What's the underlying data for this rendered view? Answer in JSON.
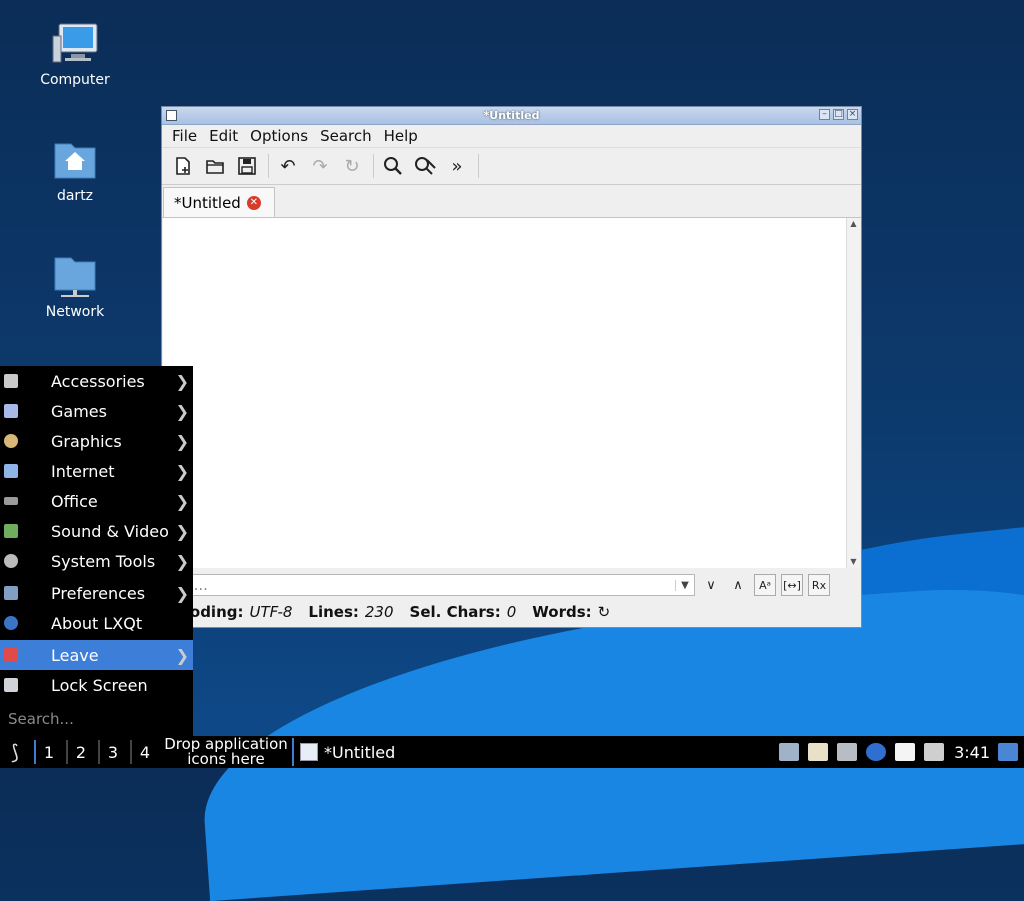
{
  "desktop": {
    "icons": [
      {
        "label": "Computer"
      },
      {
        "label": "dartz"
      },
      {
        "label": "Network"
      }
    ]
  },
  "window": {
    "title": "*Untitled",
    "menu": [
      "File",
      "Edit",
      "Options",
      "Search",
      "Help"
    ],
    "toolbar_icons": [
      "new-file-icon",
      "open-file-icon",
      "save-icon",
      "undo-icon",
      "redo-icon",
      "reload-icon",
      "find-icon",
      "replace-icon",
      "more-icon"
    ],
    "tab_label": "*Untitled",
    "search_placeholder": "rch...",
    "status": {
      "encoding_label": "coding:",
      "encoding_value": "UTF-8",
      "lines_label": "Lines:",
      "lines_value": "230",
      "selchars_label": "Sel. Chars:",
      "selchars_value": "0",
      "words_label": "Words:"
    },
    "search_buttons": [
      "Aᵃ",
      "[↔]",
      "Rx"
    ]
  },
  "startmenu": {
    "items": [
      {
        "label": "Accessories",
        "submenu": true
      },
      {
        "label": "Games",
        "submenu": true
      },
      {
        "label": "Graphics",
        "submenu": true
      },
      {
        "label": "Internet",
        "submenu": true
      },
      {
        "label": "Office",
        "submenu": true
      },
      {
        "label": "Sound & Video",
        "submenu": true
      },
      {
        "label": "System Tools",
        "submenu": true
      },
      {
        "label": "Preferences",
        "submenu": true
      },
      {
        "label": "About LXQt",
        "submenu": false
      },
      {
        "label": "Leave",
        "submenu": true,
        "active": true
      },
      {
        "label": "Lock Screen",
        "submenu": false
      }
    ],
    "search_placeholder": "Search..."
  },
  "taskbar": {
    "desktops": [
      "1",
      "2",
      "3",
      "4"
    ],
    "drop_text_line1": "Drop application",
    "drop_text_line2": "icons here",
    "task_title": "*Untitled",
    "clock": "3:41"
  },
  "colors": {
    "accent": "#3d7fd8",
    "menu_bg": "#000000",
    "desktop_bg": "#0c3a6e"
  }
}
